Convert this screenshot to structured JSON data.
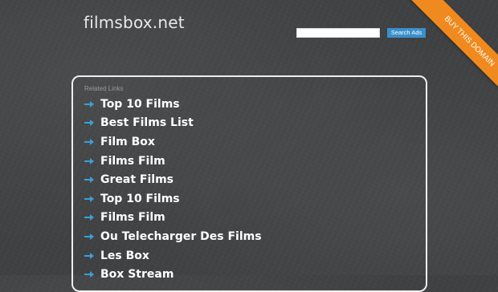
{
  "header": {
    "site_title": "filmsbox.net"
  },
  "search": {
    "placeholder": "",
    "button_label": "Search Ads"
  },
  "ribbon": {
    "label": "BUY THIS DOMAIN",
    "color": "#f08a1e"
  },
  "links_box": {
    "caption": "Related Links",
    "items": [
      {
        "label": "Top 10 Films"
      },
      {
        "label": "Best Films List"
      },
      {
        "label": "Film Box"
      },
      {
        "label": "Films Film"
      },
      {
        "label": "Great Films"
      },
      {
        "label": "Top 10 Films"
      },
      {
        "label": "Films Film"
      },
      {
        "label": "Ou Telecharger Des Films"
      },
      {
        "label": "Les Box"
      },
      {
        "label": "Box Stream"
      }
    ]
  },
  "colors": {
    "accent": "#3b8fcb",
    "arrow": "#3b9fd8",
    "background": "#3f4142"
  }
}
